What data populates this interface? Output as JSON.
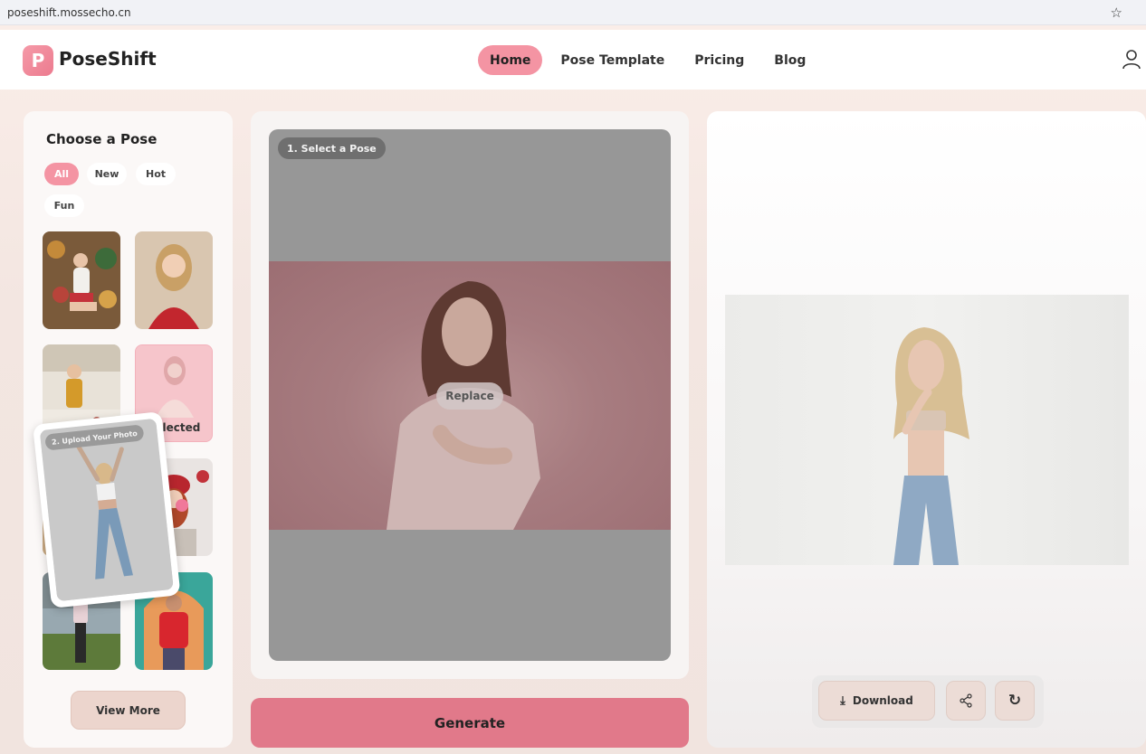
{
  "browser": {
    "url": "poseshift.mossecho.cn"
  },
  "header": {
    "logo_letter": "P",
    "logo_text": "PoseShift",
    "nav": [
      {
        "label": "Home",
        "active": true
      },
      {
        "label": "Pose Template",
        "active": false
      },
      {
        "label": "Pricing",
        "active": false
      },
      {
        "label": "Blog",
        "active": false
      }
    ]
  },
  "left_panel": {
    "title": "Choose a Pose",
    "filters": [
      {
        "label": "All",
        "active": true
      },
      {
        "label": "New",
        "active": false
      },
      {
        "label": "Hot",
        "active": false
      },
      {
        "label": "Fun",
        "active": false
      }
    ],
    "selected_label": "Selected",
    "view_more": "View More"
  },
  "middle_panel": {
    "step1_label": "1. Select a Pose",
    "replace_label": "Replace",
    "step2_label": "2. Upload Your Photo",
    "generate_label": "Generate"
  },
  "right_panel": {
    "download_label": "Download"
  },
  "colors": {
    "accent": "#f494a3",
    "generate": "#e1798a"
  }
}
